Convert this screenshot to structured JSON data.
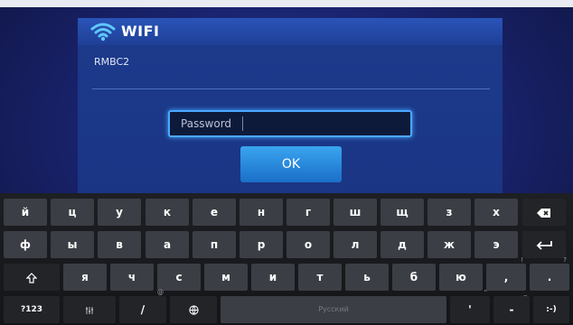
{
  "dialog": {
    "title": "WIFI",
    "ssid": "RMBC2",
    "password_placeholder": "Password",
    "ok_label": "OK"
  },
  "colors": {
    "accent": "#4aa8ff",
    "panel": "#1d3a8c",
    "ok_button": "#2a8ce0",
    "key": "#3b3e44"
  },
  "keyboard": {
    "row1": [
      "й",
      "ц",
      "у",
      "к",
      "е",
      "н",
      "г",
      "ш",
      "щ",
      "з",
      "х"
    ],
    "row1_end_icon": "backspace-icon",
    "row2": [
      "ф",
      "ы",
      "в",
      "а",
      "п",
      "р",
      "о",
      "л",
      "д",
      "ж",
      "э"
    ],
    "row2_end_icon": "enter-icon",
    "row3_start_icon": "shift-icon",
    "row3": [
      "я",
      "ч",
      "с",
      "м",
      "и",
      "т",
      "ь",
      "б",
      "ю"
    ],
    "row3_comma": ",",
    "row3_comma_sup": "!",
    "row3_period": ".",
    "row3_period_sup": "?",
    "row4": {
      "numbers": "?123",
      "settings_icon": "settings-icon",
      "slash": "/",
      "slash_sup": "@",
      "globe_icon": "globe-icon",
      "space": "Русский",
      "quote": "'",
      "quote_sup": "\"",
      "dash": "-",
      "dash_sup": "_",
      "smiley": ":-)"
    }
  }
}
